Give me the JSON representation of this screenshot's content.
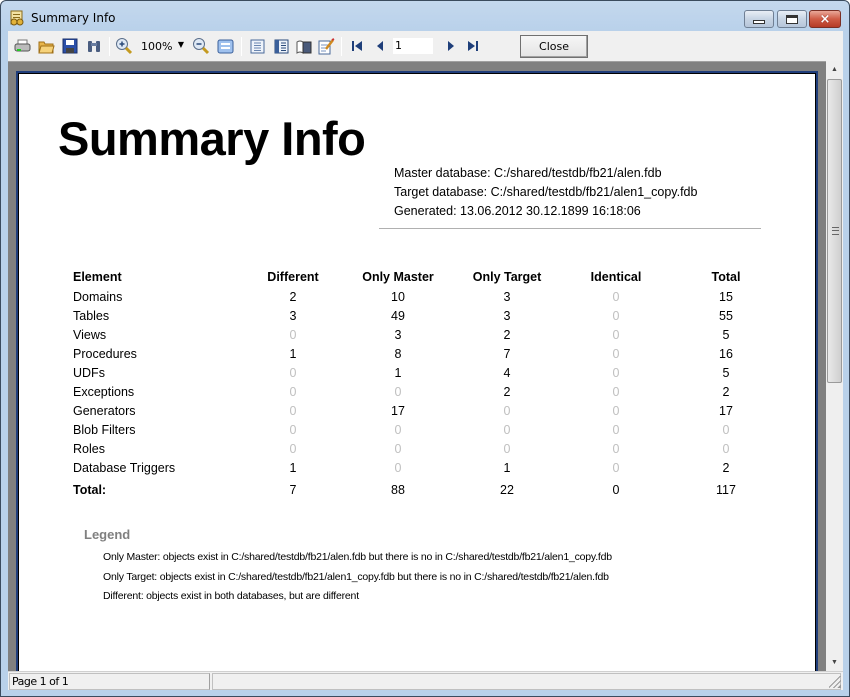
{
  "window": {
    "title": "Summary Info",
    "icon": "app-report-icon",
    "controls": {
      "minimize": "minimize-icon",
      "maximize": "maximize-icon",
      "close": "×"
    }
  },
  "toolbar": {
    "zoom_value": "100%",
    "page_number": "1",
    "close_label": "Close",
    "icons": [
      "print-icon",
      "open-icon",
      "save-icon",
      "find-icon",
      "zoom-in-icon",
      "zoom-out-icon",
      "page-width-icon",
      "single-page-icon",
      "multi-page-icon",
      "book-icon",
      "edit-icon",
      "first-page-icon",
      "prev-page-icon",
      "next-page-icon",
      "last-page-icon"
    ]
  },
  "report": {
    "title": "Summary Info",
    "master_database": "Master database: C:/shared/testdb/fb21/alen.fdb",
    "target_database": "Target database: C:/shared/testdb/fb21/alen1_copy.fdb",
    "generated": "Generated: 13.06.2012 30.12.1899 16:18:06",
    "columns": [
      "Element",
      "Different",
      "Only Master",
      "Only Target",
      "Identical",
      "Total"
    ],
    "rows": [
      [
        "Domains",
        "2",
        "10",
        "3",
        "0",
        "15"
      ],
      [
        "Tables",
        "3",
        "49",
        "3",
        "0",
        "55"
      ],
      [
        "Views",
        "0",
        "3",
        "2",
        "0",
        "5"
      ],
      [
        "Procedures",
        "1",
        "8",
        "7",
        "0",
        "16"
      ],
      [
        "UDFs",
        "0",
        "1",
        "4",
        "0",
        "5"
      ],
      [
        "Exceptions",
        "0",
        "0",
        "2",
        "0",
        "2"
      ],
      [
        "Generators",
        "0",
        "17",
        "0",
        "0",
        "17"
      ],
      [
        "Blob Filters",
        "0",
        "0",
        "0",
        "0",
        "0"
      ],
      [
        "Roles",
        "0",
        "0",
        "0",
        "0",
        "0"
      ],
      [
        "Database Triggers",
        "1",
        "0",
        "1",
        "0",
        "2"
      ]
    ],
    "total_row": [
      "Total:",
      "7",
      "88",
      "22",
      "0",
      "117"
    ],
    "legend": {
      "title": "Legend",
      "items": [
        "Only Master: objects exist in C:/shared/testdb/fb21/alen.fdb but there is no in C:/shared/testdb/fb21/alen1_copy.fdb",
        "Only Target: objects exist in C:/shared/testdb/fb21/alen1_copy.fdb but there is no in C:/shared/testdb/fb21/alen.fdb",
        "Different:  objects exist in both databases, but are different"
      ]
    }
  },
  "statusbar": {
    "page_info": "Page 1 of 1",
    "secondary": ""
  },
  "colors": {
    "page_border": "#1f3d7a",
    "zero_value": "#c0c0c0",
    "legend_title": "#808080",
    "preview_background": "#808080"
  }
}
